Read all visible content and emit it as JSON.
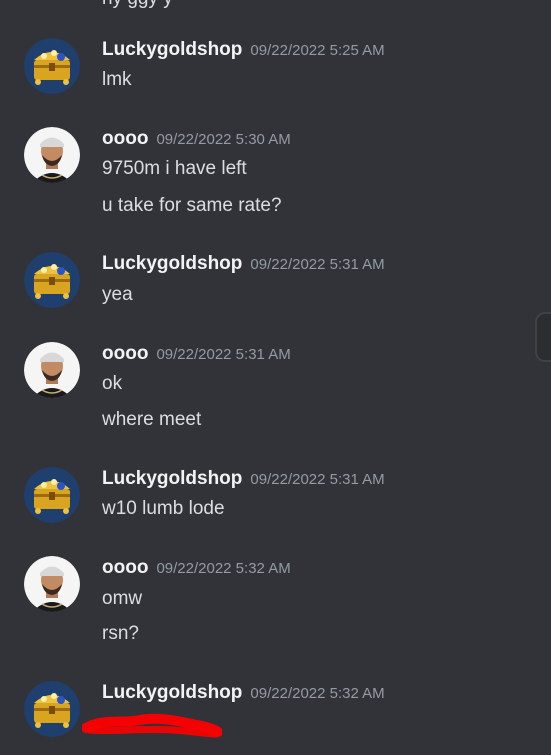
{
  "colors": {
    "background": "#313338",
    "username": "#f2f3f5",
    "timestamp": "#949ba4",
    "text": "#dbdee1",
    "redaction": "#ff0000"
  },
  "icons": {
    "shop_avatar": "treasure-chest-avatar",
    "user_avatar": "man-portrait-avatar"
  },
  "top_partial_text": "ny        ggy  y",
  "messages": [
    {
      "username": "Luckygoldshop",
      "timestamp": "09/22/2022 5:25 AM",
      "lines": [
        "lmk"
      ]
    },
    {
      "username": "oooo",
      "timestamp": "09/22/2022 5:30 AM",
      "lines": [
        "9750m i have left",
        "u take for same rate?"
      ]
    },
    {
      "username": "Luckygoldshop",
      "timestamp": "09/22/2022 5:31 AM",
      "lines": [
        "yea"
      ]
    },
    {
      "username": "oooo",
      "timestamp": "09/22/2022 5:31 AM",
      "lines": [
        "ok",
        "where meet"
      ]
    },
    {
      "username": "Luckygoldshop",
      "timestamp": "09/22/2022 5:31 AM",
      "lines": [
        "w10 lumb lode"
      ]
    },
    {
      "username": "oooo",
      "timestamp": "09/22/2022 5:32 AM",
      "lines": [
        "omw",
        "rsn?"
      ]
    },
    {
      "username": "Luckygoldshop",
      "timestamp": "09/22/2022 5:32 AM",
      "lines": []
    }
  ]
}
